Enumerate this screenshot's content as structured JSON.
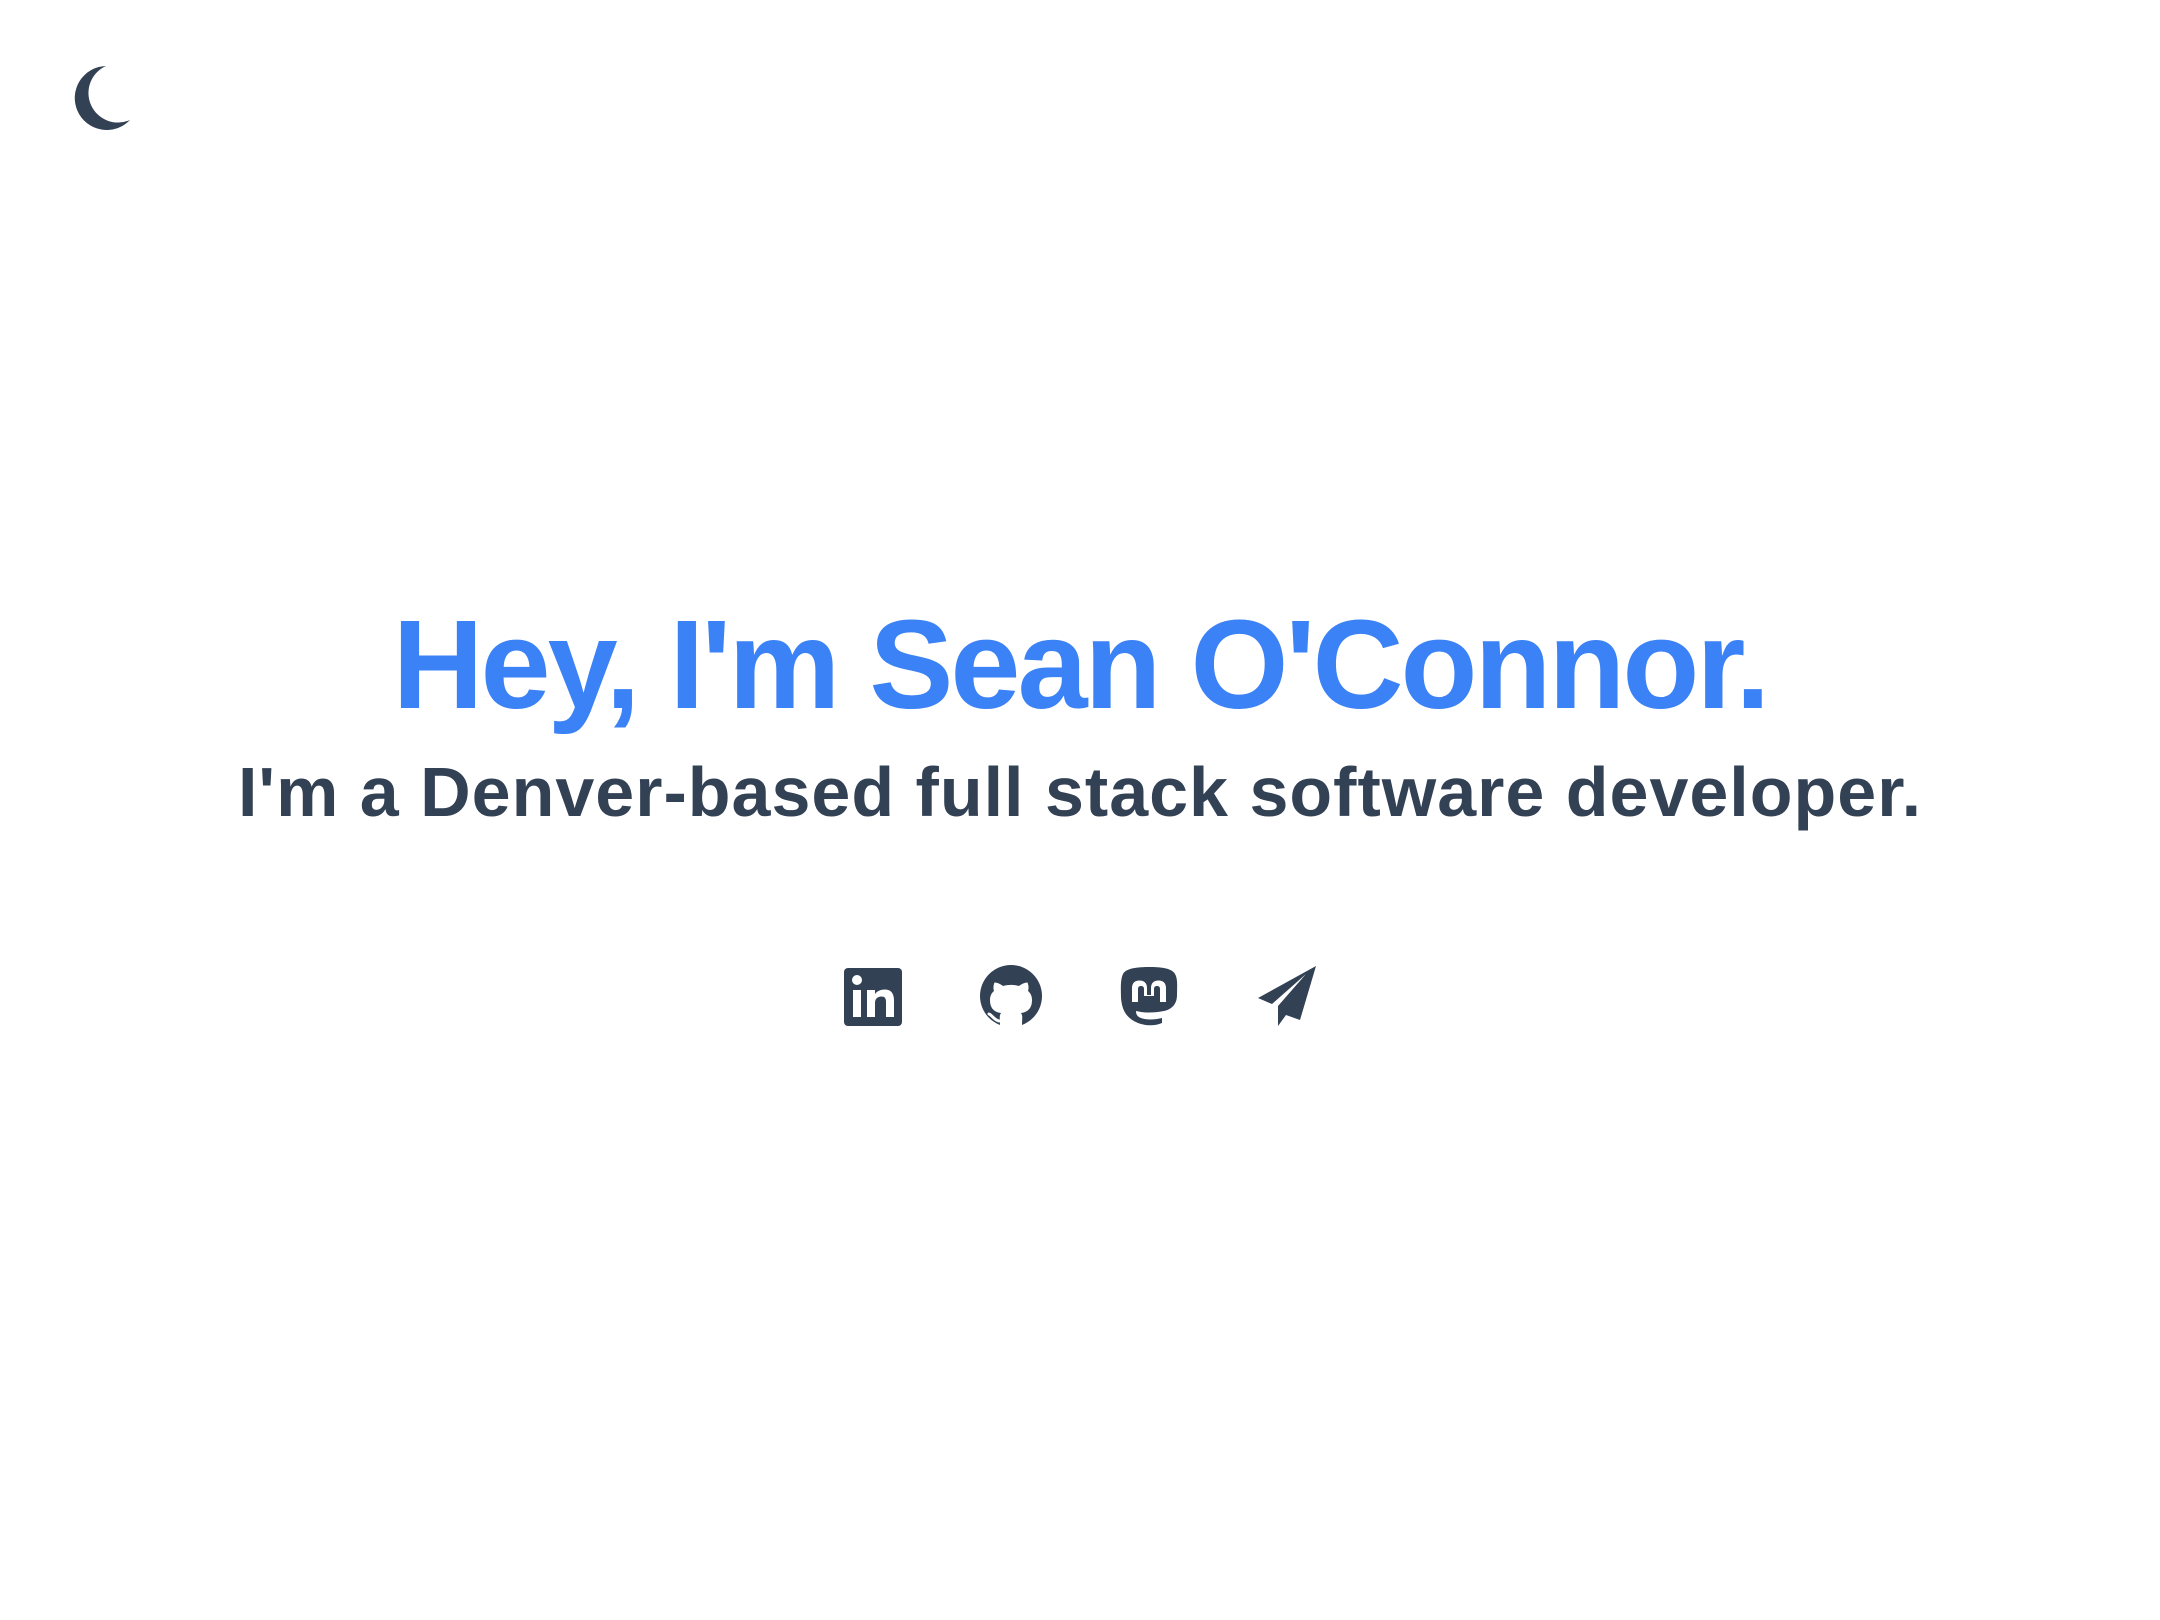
{
  "header": {
    "theme_toggle_icon": "moon-icon"
  },
  "hero": {
    "headline": "Hey, I'm Sean O'Connor.",
    "subheadline": "I'm a Denver-based full stack software developer."
  },
  "social_links": [
    {
      "icon": "linkedin-icon"
    },
    {
      "icon": "github-icon"
    },
    {
      "icon": "mastodon-icon"
    },
    {
      "icon": "paper-plane-icon"
    }
  ],
  "colors": {
    "accent": "#3b82f6",
    "text": "#334155",
    "background": "#ffffff"
  }
}
